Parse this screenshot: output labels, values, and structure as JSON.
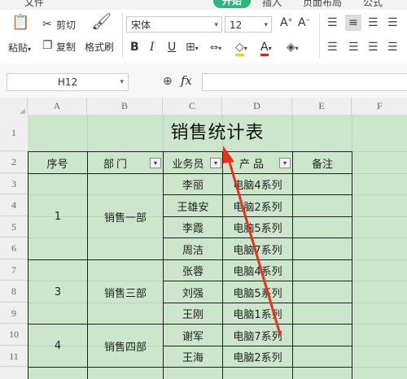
{
  "menu": {
    "file": "文件",
    "start": "开始",
    "insert": "插入",
    "page_layout": "页面布局",
    "formula": "公式"
  },
  "ribbon": {
    "paste": "粘贴",
    "cut": "剪切",
    "copy": "复制",
    "format_painter": "格式刷",
    "font_name": "宋体",
    "font_size": "12",
    "grow_font": "A",
    "shrink_font": "A",
    "bold": "B",
    "italic": "I",
    "underline": "U",
    "font_color": "A"
  },
  "formula_bar": {
    "cell_ref": "H12",
    "fx": "fx",
    "value": ""
  },
  "columns": [
    "A",
    "B",
    "C",
    "D",
    "E",
    "F"
  ],
  "rows": [
    "1",
    "2",
    "3",
    "4",
    "5",
    "6",
    "7",
    "8",
    "9",
    "10",
    "11"
  ],
  "table": {
    "title": "销售统计表",
    "headers": {
      "no": "序号",
      "dept": "部门",
      "staff": "业务员",
      "product": "产品",
      "note": "备注"
    },
    "groups": [
      {
        "no": "1",
        "dept": "销售一部"
      },
      {
        "no": "3",
        "dept": "销售三部"
      },
      {
        "no": "4",
        "dept": "销售四部"
      }
    ],
    "records": [
      {
        "staff": "李丽",
        "product": "电脑4系列"
      },
      {
        "staff": "王雄安",
        "product": "电脑2系列"
      },
      {
        "staff": "李霞",
        "product": "电脑5系列"
      },
      {
        "staff": "周洁",
        "product": "电脑7系列"
      },
      {
        "staff": "张蓉",
        "product": "电脑4系列"
      },
      {
        "staff": "刘强",
        "product": "电脑5系列"
      },
      {
        "staff": "王刚",
        "product": "电脑1系列"
      },
      {
        "staff": "谢军",
        "product": "电脑7系列"
      },
      {
        "staff": "王海",
        "product": "电脑2系列"
      }
    ]
  },
  "colors": {
    "sheet_bg": "#cbe6cb",
    "accent_green": "#2fb67a",
    "annotation_arrow": "#e8321e"
  }
}
